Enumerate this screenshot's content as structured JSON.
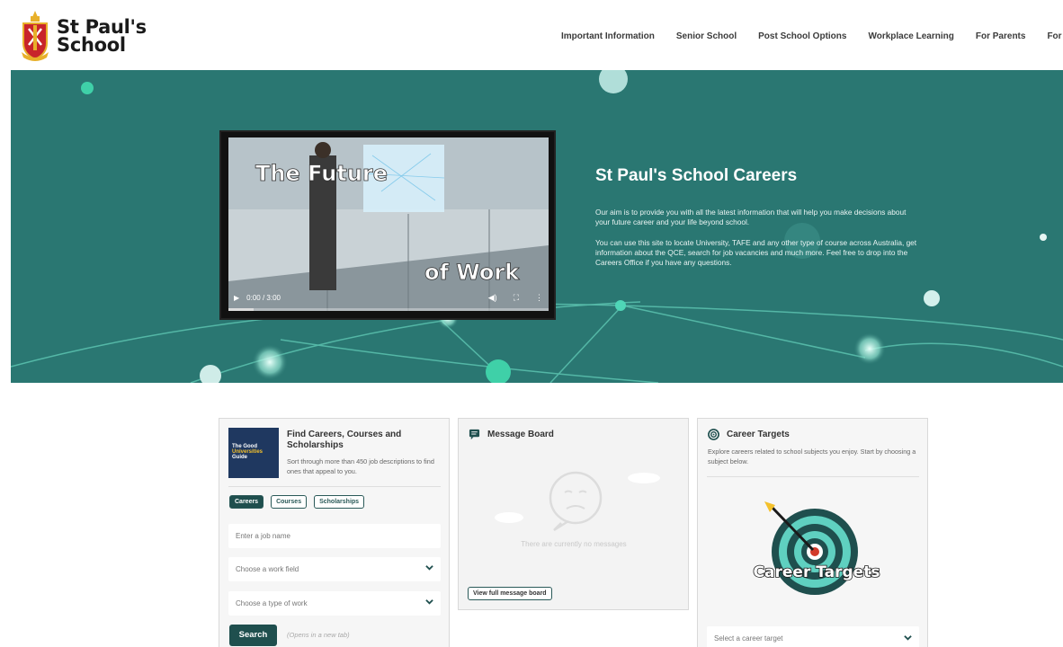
{
  "brand": {
    "line1": "St Paul's",
    "line2": "School"
  },
  "nav": [
    "Important Information",
    "Senior School",
    "Post School Options",
    "Workplace Learning",
    "For Parents",
    "For Students"
  ],
  "hero": {
    "video": {
      "title_top": "The Future",
      "title_bottom": "of Work",
      "time": "0:00 / 3:00",
      "progress": 0.08
    },
    "title": "St Paul's School Careers",
    "p1": "Our aim is to provide you with all the latest information that will help you make decisions about your future career and your life beyond school.",
    "p2": "You can use this site to locate University, TAFE and any other type of course across Australia, get information about the QCE, search for job vacancies and much more. Feel free to drop into the Careers Office if you have any questions."
  },
  "find": {
    "logo_lines": [
      "The Good",
      "Universities",
      "Guide"
    ],
    "title": "Find Careers, Courses and Scholarships",
    "desc": "Sort through more than 450 job descriptions to find ones that appeal to you.",
    "tabs": [
      "Careers",
      "Courses",
      "Scholarships"
    ],
    "job_placeholder": "Enter a job name",
    "work_field": "Choose a work field",
    "work_type": "Choose a type of work",
    "search_label": "Search",
    "search_note": "(Opens in a new tab)"
  },
  "message": {
    "title": "Message Board",
    "empty": "There are currently no messages",
    "view_all": "View full message board"
  },
  "targets": {
    "title": "Career Targets",
    "desc": "Explore careers related to school subjects you enjoy. Start by choosing a subject below.",
    "graphic_label": "Career Targets",
    "select": "Select a career target"
  },
  "colors": {
    "teal": "#2a7772",
    "dark_teal": "#1f4f4e",
    "navy": "#1f3860",
    "crest_red": "#c8242b",
    "crest_gold": "#e8b02a"
  }
}
